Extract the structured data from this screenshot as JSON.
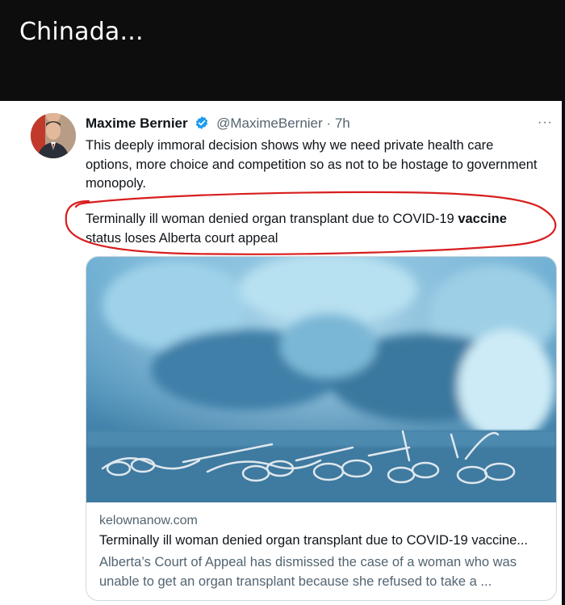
{
  "caption": "Chinada...",
  "tweet": {
    "author_name": "Maxime Bernier",
    "handle": "@MaximeBernier",
    "separator": "·",
    "time": "7h",
    "more_label": "···",
    "text": "This deeply immoral decision shows why we need private health care options, more choice and competition so as not to be hostage to government monopoly.",
    "quote_before": "Terminally ill woman denied organ transplant due to COVID-19 ",
    "quote_bold": "vaccine",
    "quote_after": " status loses Alberta court appeal"
  },
  "link_card": {
    "domain": "kelownanow.com",
    "title": "Terminally ill woman denied organ transplant due to COVID-19 vaccine...",
    "description": "Alberta’s Court of Appeal has dismissed the case of a woman who was unable to get an organ transplant because she refused to take a ..."
  },
  "colors": {
    "background": "#0d0d0d",
    "card": "#ffffff",
    "verified": "#1d9bf0",
    "highlight_circle": "#d81e1e",
    "secondary_text": "#536471"
  }
}
